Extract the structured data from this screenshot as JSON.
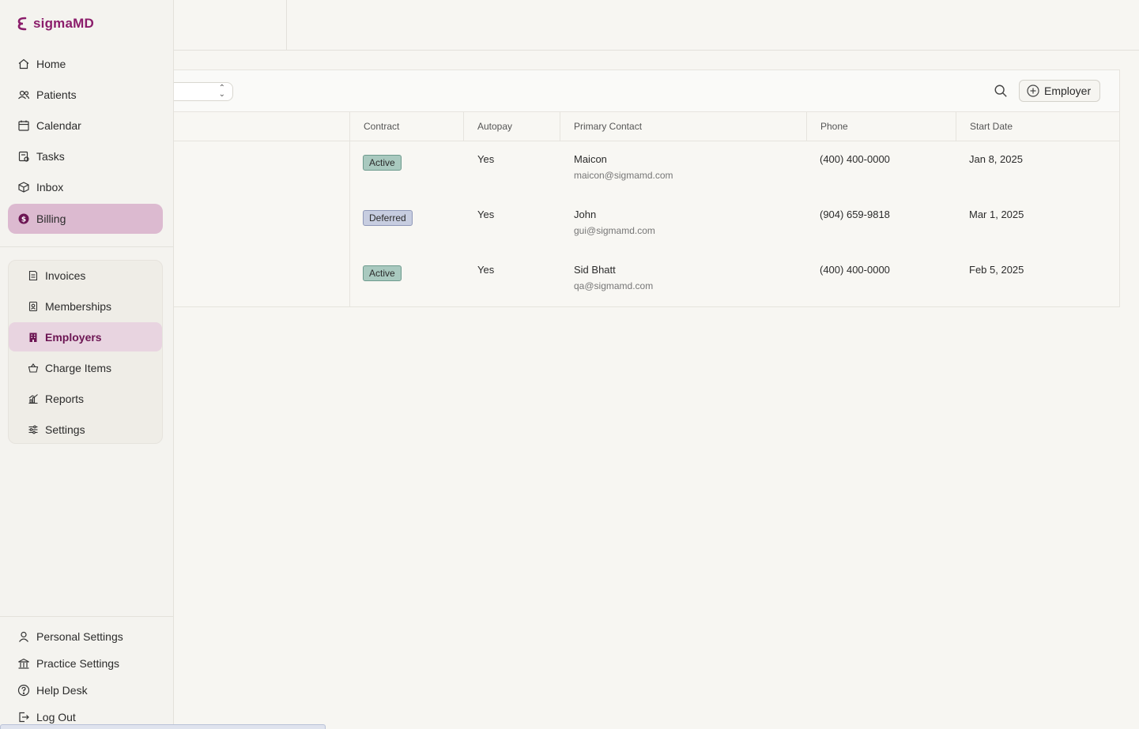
{
  "brand": {
    "name": "sigmaMD",
    "color": "#8b1d6b"
  },
  "sidebar": {
    "nav": [
      {
        "id": "home",
        "label": "Home",
        "icon": "home-icon"
      },
      {
        "id": "patients",
        "label": "Patients",
        "icon": "users-icon"
      },
      {
        "id": "calendar",
        "label": "Calendar",
        "icon": "calendar-icon"
      },
      {
        "id": "tasks",
        "label": "Tasks",
        "icon": "tasks-icon"
      },
      {
        "id": "inbox",
        "label": "Inbox",
        "icon": "inbox-icon"
      },
      {
        "id": "billing",
        "label": "Billing",
        "icon": "dollar-icon",
        "active": true
      }
    ],
    "billing_sub": [
      {
        "id": "invoices",
        "label": "Invoices",
        "icon": "invoice-icon"
      },
      {
        "id": "memberships",
        "label": "Memberships",
        "icon": "membership-icon"
      },
      {
        "id": "employers",
        "label": "Employers",
        "icon": "building-icon",
        "active": true
      },
      {
        "id": "charge-items",
        "label": "Charge Items",
        "icon": "basket-icon"
      },
      {
        "id": "reports",
        "label": "Reports",
        "icon": "chart-icon"
      },
      {
        "id": "settings",
        "label": "Settings",
        "icon": "sliders-icon"
      }
    ],
    "footer": [
      {
        "id": "personal-settings",
        "label": "Personal Settings",
        "icon": "user-icon"
      },
      {
        "id": "practice-settings",
        "label": "Practice Settings",
        "icon": "practice-icon"
      },
      {
        "id": "help-desk",
        "label": "Help Desk",
        "icon": "help-icon"
      },
      {
        "id": "log-out",
        "label": "Log Out",
        "icon": "logout-icon"
      }
    ]
  },
  "toolbar": {
    "add_label": "Employer"
  },
  "table": {
    "headers": [
      "Contract",
      "Autopay",
      "Primary Contact",
      "Phone",
      "Start Date"
    ],
    "rows": [
      {
        "contract": "Active",
        "autopay": "Yes",
        "contact_name": "Maicon",
        "contact_email": "maicon@sigmamd.com",
        "phone": "(400) 400-0000",
        "start_date": "Jan 8, 2025"
      },
      {
        "contract": "Deferred",
        "autopay": "Yes",
        "contact_name": "John",
        "contact_email": "gui@sigmamd.com",
        "phone": "(904) 659-9818",
        "start_date": "Mar 1, 2025"
      },
      {
        "contract": "Active",
        "autopay": "Yes",
        "contact_name": "Sid Bhatt",
        "contact_email": "qa@sigmamd.com",
        "phone": "(400) 400-0000",
        "start_date": "Feb 5, 2025"
      }
    ]
  },
  "colors": {
    "active_badge_bg": "#a9c9bf",
    "active_badge_border": "#6d9a8d",
    "deferred_badge_bg": "#c7cde0",
    "deferred_badge_border": "#8f98b8",
    "billing_active_bg": "#dcbad0",
    "employers_active_bg": "#e8d4e0"
  }
}
